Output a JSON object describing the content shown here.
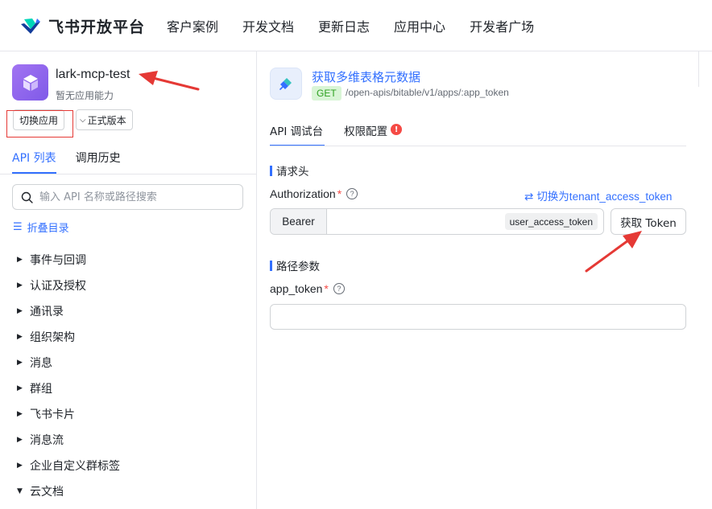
{
  "brand": {
    "name": "飞书开放平台"
  },
  "nav": {
    "items": [
      "客户案例",
      "开发文档",
      "更新日志",
      "应用中心",
      "开发者广场"
    ]
  },
  "app": {
    "name": "lark-mcp-test",
    "subtitle": "暂无应用能力",
    "switch_label": "切换应用",
    "version_label": "正式版本"
  },
  "left_tabs": {
    "api_list": "API 列表",
    "history": "调用历史"
  },
  "search": {
    "placeholder": "输入 API 名称或路径搜索"
  },
  "collapse": {
    "label": "折叠目录"
  },
  "categories": [
    {
      "label": "事件与回调",
      "expanded": false
    },
    {
      "label": "认证及授权",
      "expanded": false
    },
    {
      "label": "通讯录",
      "expanded": false
    },
    {
      "label": "组织架构",
      "expanded": false
    },
    {
      "label": "消息",
      "expanded": false
    },
    {
      "label": "群组",
      "expanded": false
    },
    {
      "label": "飞书卡片",
      "expanded": false
    },
    {
      "label": "消息流",
      "expanded": false
    },
    {
      "label": "企业自定义群标签",
      "expanded": false
    },
    {
      "label": "云文档",
      "expanded": true
    }
  ],
  "api": {
    "title": "获取多维表格元数据",
    "method": "GET",
    "path": "/open-apis/bitable/v1/apps/:app_token"
  },
  "right_tabs": {
    "console": "API 调试台",
    "permissions": "权限配置",
    "permissions_warning": "!"
  },
  "request_header": {
    "section_title": "请求头",
    "auth_label": "Authorization",
    "required_mark": "*",
    "help": "?",
    "switch_token": "切换为tenant_access_token",
    "bearer": "Bearer",
    "token_type": "user_access_token",
    "get_token": "获取 Token"
  },
  "path_params": {
    "section_title": "路径参数",
    "field_label": "app_token",
    "required_mark": "*",
    "help": "?"
  },
  "colors": {
    "accent": "#3370ff",
    "annotation": "#e53935",
    "method_bg": "#d9f5d6",
    "method_fg": "#2ea121"
  }
}
